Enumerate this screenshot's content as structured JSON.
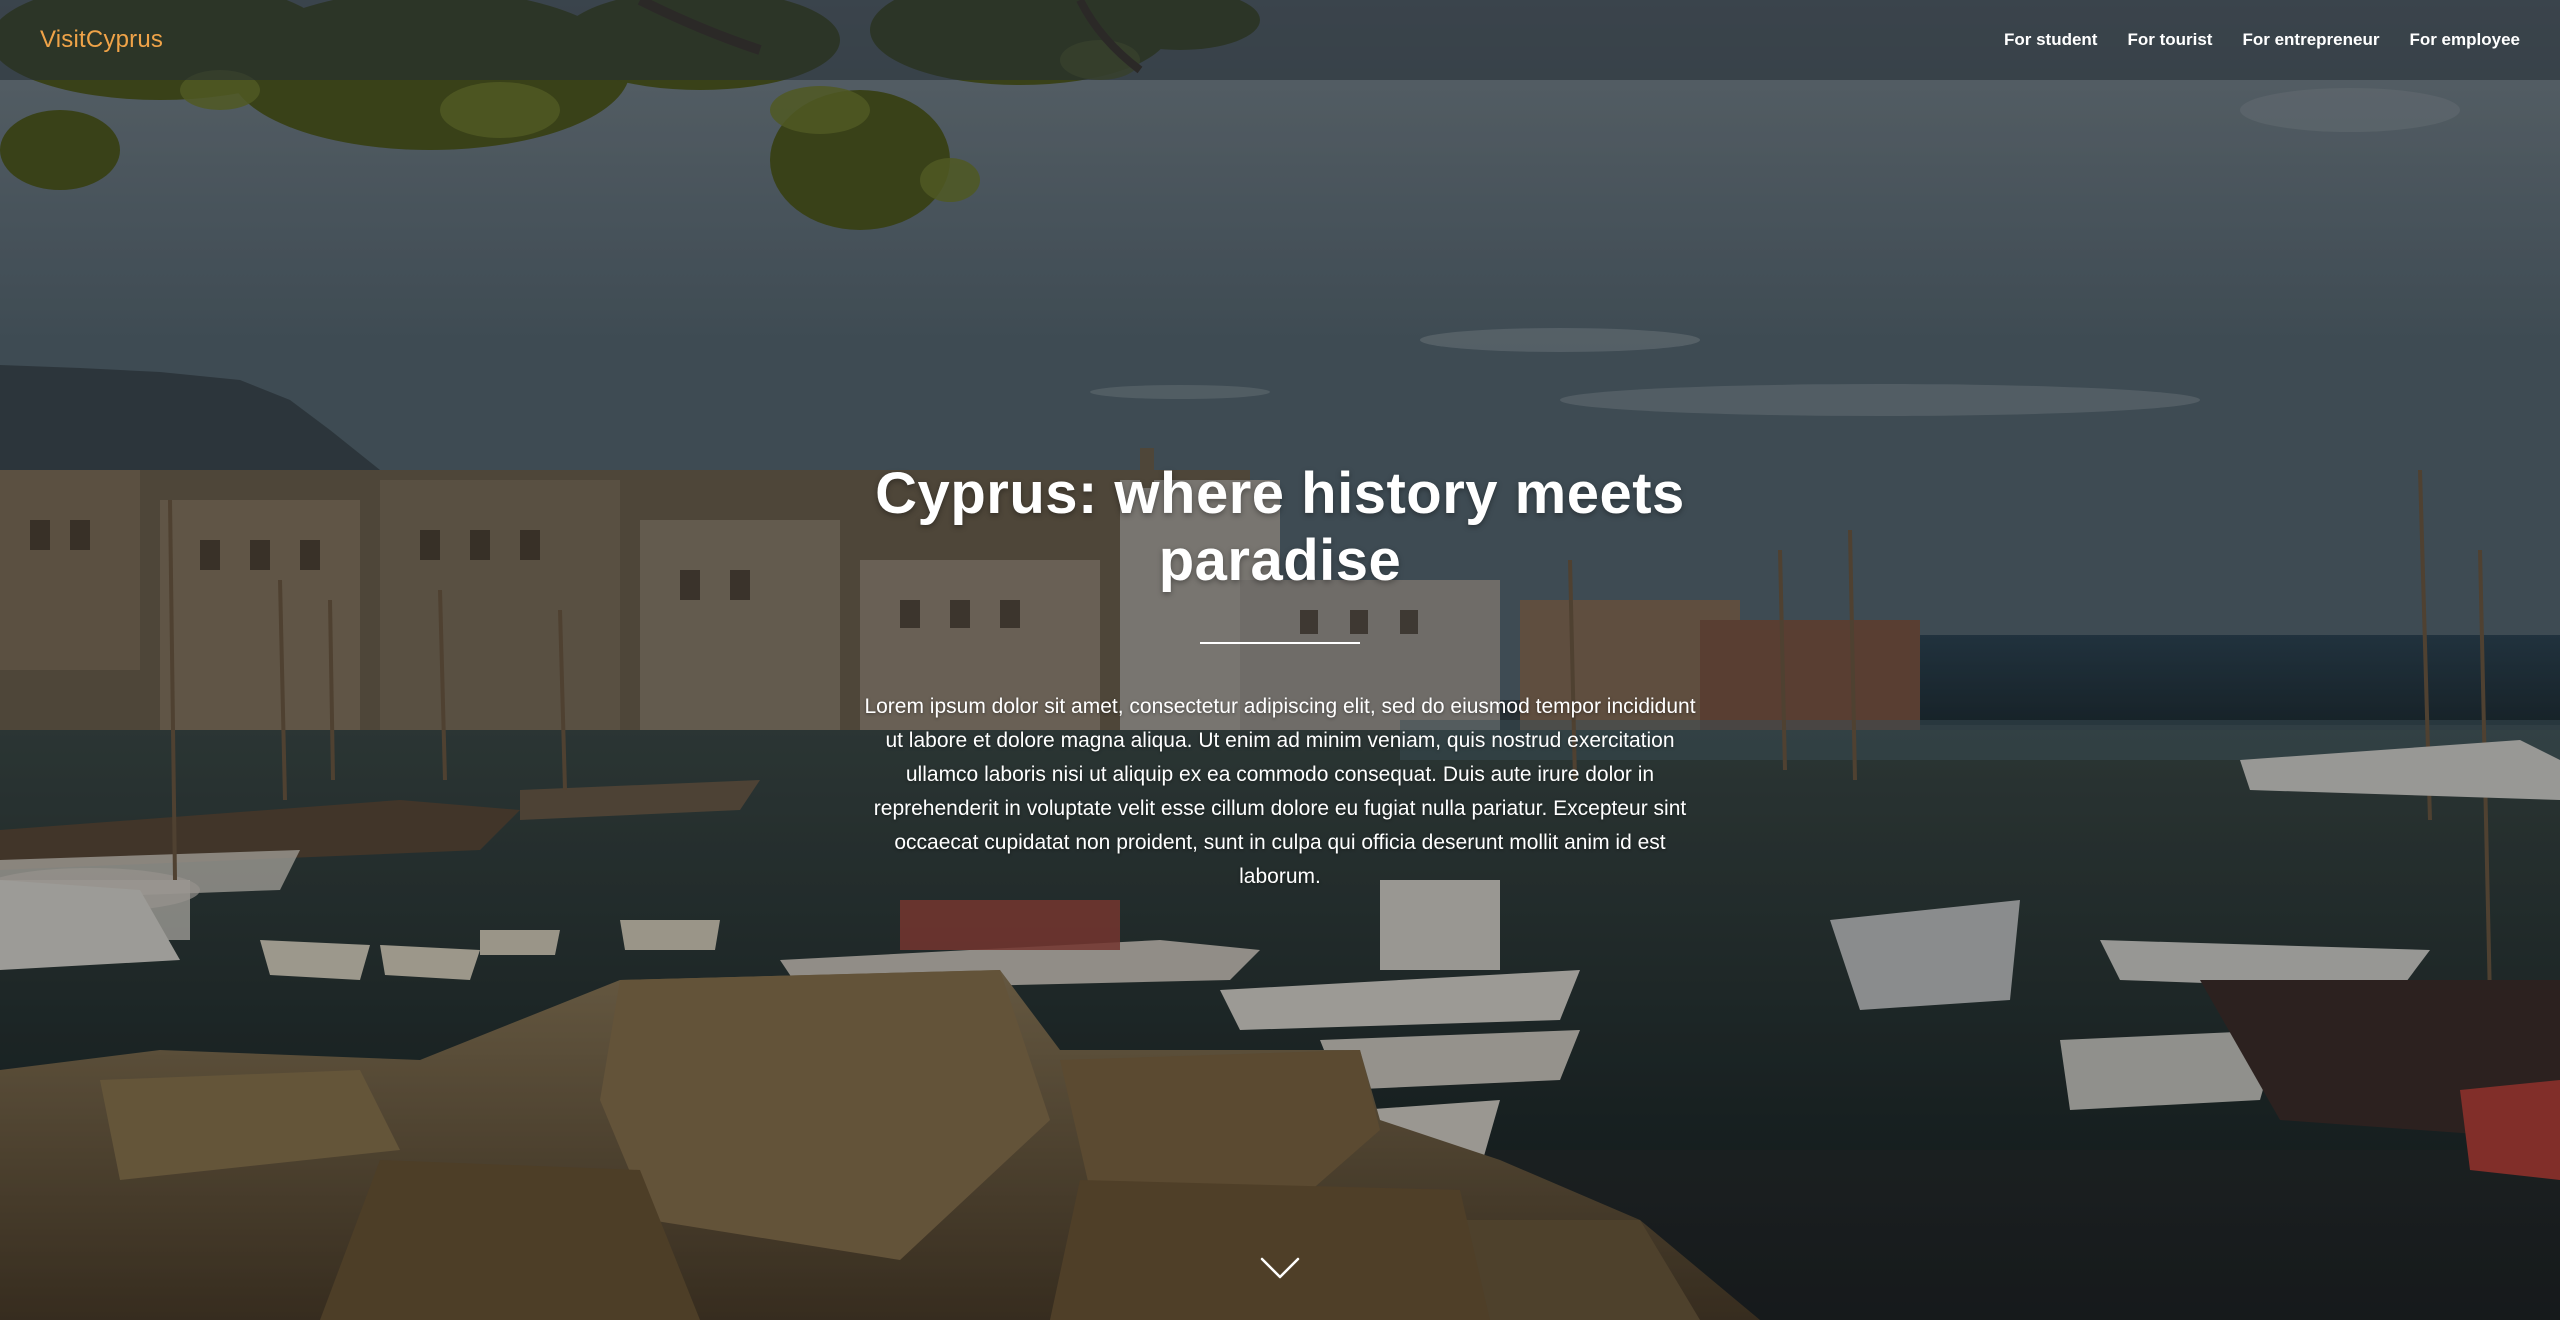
{
  "nav": {
    "brand": "VisitCyprus",
    "links": [
      {
        "label": "For student"
      },
      {
        "label": "For tourist"
      },
      {
        "label": "For entrepreneur"
      },
      {
        "label": "For employee"
      }
    ]
  },
  "hero": {
    "title": "Cyprus: where history meets paradise",
    "lead": "Lorem ipsum dolor sit amet, consectetur adipiscing elit, sed do eiusmod tempor incididunt ut labore et dolore magna aliqua. Ut enim ad minim veniam, quis nostrud exercitation ullamco laboris nisi ut aliquip ex ea commodo consequat. Duis aute irure dolor in reprehenderit in voluptate velit esse cillum dolore eu fugiat nulla pariatur. Excepteur sint occaecat cupidatat non proident, sunt in culpa qui officia deserunt mollit anim id est laborum.",
    "scroll_icon": "chevron-down-icon"
  },
  "colors": {
    "brand": "#f0a348",
    "nav_text": "#ffffff"
  }
}
